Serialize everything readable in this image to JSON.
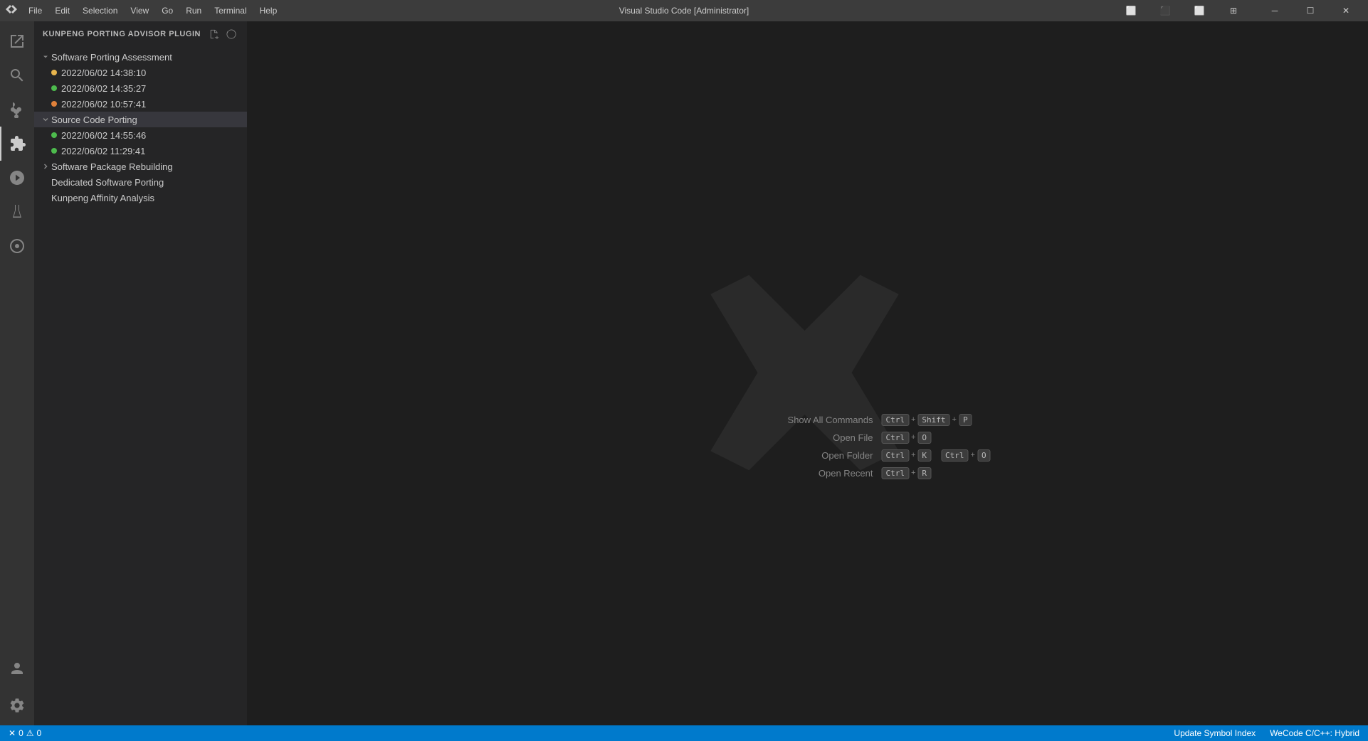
{
  "window": {
    "title": "Visual Studio Code [Administrator]"
  },
  "menu": {
    "items": [
      "File",
      "Edit",
      "Selection",
      "View",
      "Go",
      "Run",
      "Terminal",
      "Help"
    ]
  },
  "sidebar": {
    "plugin_title": "KUNPENG PORTING ADVISOR PLUGIN",
    "tree": {
      "software_porting_assessment": {
        "label": "Software Porting Assessment",
        "expanded": true,
        "children": [
          {
            "label": "2022/06/02 14:38:10",
            "dot": "yellow"
          },
          {
            "label": "2022/06/02 14:35:27",
            "dot": "green"
          },
          {
            "label": "2022/06/02 10:57:41",
            "dot": "orange"
          }
        ]
      },
      "source_code_porting": {
        "label": "Source Code Porting",
        "expanded": true,
        "children": [
          {
            "label": "2022/06/02 14:55:46",
            "dot": "green"
          },
          {
            "label": "2022/06/02 11:29:41",
            "dot": "green"
          }
        ]
      },
      "software_package_rebuilding": {
        "label": "Software Package Rebuilding",
        "expanded": false
      },
      "dedicated_software_porting": {
        "label": "Dedicated Software Porting"
      },
      "kunpeng_affinity_analysis": {
        "label": "Kunpeng Affinity Analysis"
      }
    }
  },
  "editor": {
    "shortcuts": [
      {
        "label": "Show All Commands",
        "keys": [
          "Ctrl",
          "Shift",
          "P"
        ]
      },
      {
        "label": "Open File",
        "keys": [
          "Ctrl",
          "O"
        ]
      },
      {
        "label": "Open Folder",
        "keys": [
          "Ctrl",
          "K",
          "Ctrl",
          "O"
        ]
      },
      {
        "label": "Open Recent",
        "keys": [
          "Ctrl",
          "R"
        ]
      }
    ]
  },
  "status_bar": {
    "left": {
      "error_icon": "✕",
      "error_count": "0",
      "warning_icon": "⚠",
      "warning_count": "0"
    },
    "right": {
      "update_symbol_index": "Update Symbol Index",
      "language": "WeCode C/C++: Hybrid"
    }
  }
}
